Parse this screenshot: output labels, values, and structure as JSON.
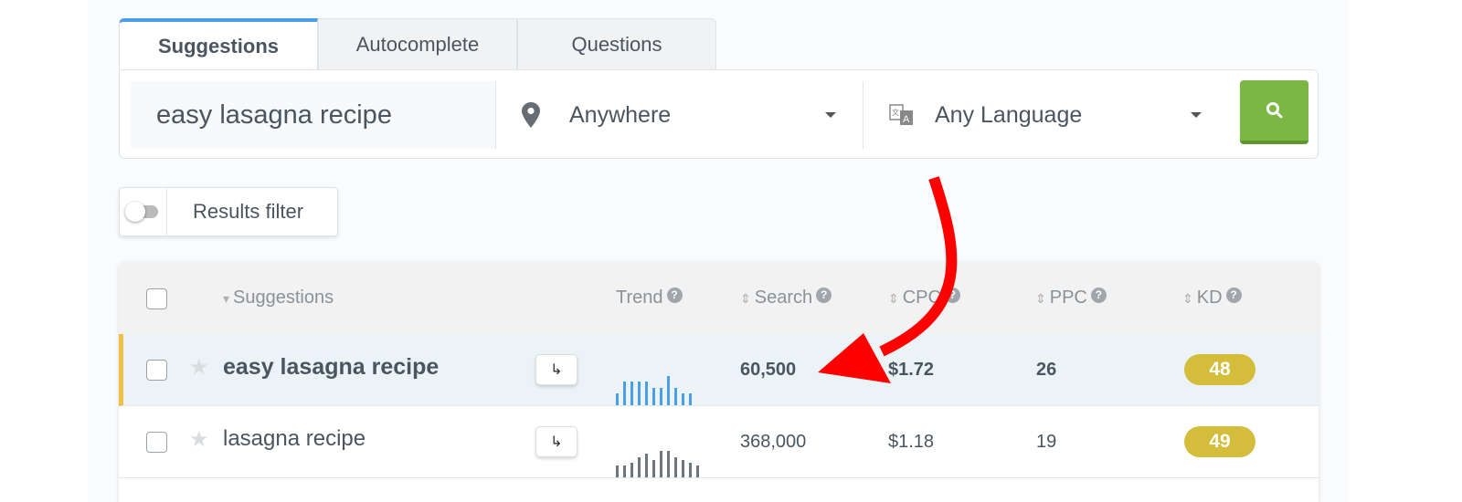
{
  "tabs": [
    {
      "label": "Suggestions",
      "active": true
    },
    {
      "label": "Autocomplete"
    },
    {
      "label": "Questions"
    }
  ],
  "search": {
    "keyword": "easy lasagna recipe",
    "location": "Anywhere",
    "language": "Any Language",
    "location_icon": "map-pin-icon",
    "language_icon": "translate-icon",
    "button_icon": "search-icon",
    "button_color": "#7ab843"
  },
  "filter": {
    "label": "Results filter",
    "enabled": false
  },
  "table": {
    "headers": {
      "suggestions": "Suggestions",
      "trend": "Trend",
      "search": "Search",
      "cpc": "CPC",
      "ppc": "PPC",
      "kd": "KD"
    },
    "rows": [
      {
        "keyword": "easy lasagna recipe",
        "search": "60,500",
        "cpc": "$1.72",
        "ppc": "26",
        "kd": "48",
        "highlighted": true,
        "trend": [
          4,
          8,
          8,
          8,
          8,
          6,
          6,
          10,
          6,
          4,
          4
        ],
        "trend_color": "#4aa0e6"
      },
      {
        "keyword": "lasagna recipe",
        "search": "368,000",
        "cpc": "$1.18",
        "ppc": "19",
        "kd": "49",
        "highlighted": false,
        "trend": [
          4,
          4,
          5,
          7,
          8,
          6,
          9,
          9,
          7,
          6,
          5,
          4
        ],
        "trend_color": "#6d7780"
      }
    ]
  },
  "kd_color": "#d4bd3b",
  "annotation": {
    "type": "arrow",
    "color": "#ff0000",
    "points_to": "60,500"
  }
}
